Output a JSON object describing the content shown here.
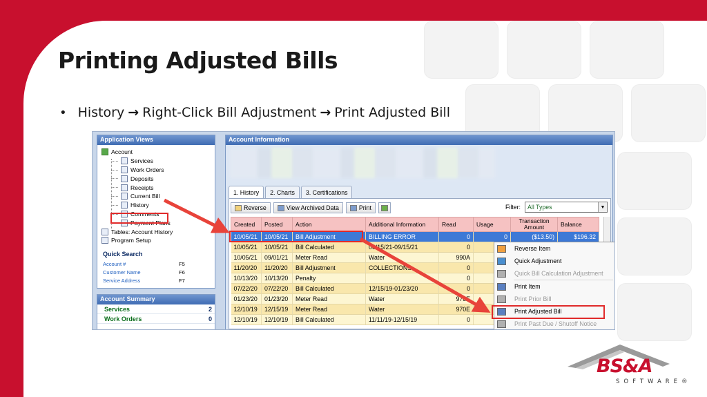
{
  "slide": {
    "title": "Printing Adjusted Bills",
    "bullet": {
      "step1": "History",
      "step2": "Right-Click Bill Adjustment",
      "step3": "Print Adjusted Bill"
    }
  },
  "app_views": {
    "header": "Application Views",
    "root": "Account",
    "items": [
      "Services",
      "Work Orders",
      "Deposits",
      "Receipts",
      "Current Bill",
      "History",
      "Comments",
      "Payment Plans"
    ],
    "tables": "Tables: Account History",
    "program_setup": "Program Setup"
  },
  "quick_search": {
    "title": "Quick Search",
    "rows": [
      {
        "label": "Account #",
        "key": "F5"
      },
      {
        "label": "Customer Name",
        "key": "F6"
      },
      {
        "label": "Service Address",
        "key": "F7"
      }
    ]
  },
  "account_summary": {
    "header": "Account Summary",
    "rows": [
      {
        "label": "Services",
        "value": "2"
      },
      {
        "label": "Work Orders",
        "value": "0"
      }
    ]
  },
  "account_info": {
    "header": "Account Information"
  },
  "tabs": [
    "1. History",
    "2. Charts",
    "3. Certifications"
  ],
  "toolbar": {
    "reverse": "Reverse",
    "view_archived": "View Archived Data",
    "print": "Print",
    "filter_label": "Filter:",
    "filter_value": "All Types"
  },
  "grid": {
    "columns": [
      "Created",
      "Posted",
      "Action",
      "Additional Information",
      "Read",
      "Usage",
      "Transaction Amount",
      "Balance"
    ],
    "rows": [
      [
        "10/05/21",
        "10/05/21",
        "Bill Adjustment",
        "BILLING ERROR",
        "0",
        "0",
        "($13.50)",
        "$196.32"
      ],
      [
        "10/05/21",
        "10/05/21",
        "Bill Calculated",
        "06/15/21-09/15/21",
        "0",
        "",
        "",
        ""
      ],
      [
        "10/05/21",
        "09/01/21",
        "Meter Read",
        "Water",
        "990A",
        "",
        "",
        ""
      ],
      [
        "11/20/20",
        "11/20/20",
        "Bill Adjustment",
        "COLLECTIONS",
        "0",
        "",
        "",
        ""
      ],
      [
        "10/13/20",
        "10/13/20",
        "Penalty",
        "",
        "0",
        "",
        "",
        ""
      ],
      [
        "07/22/20",
        "07/22/20",
        "Bill Calculated",
        "12/15/19-01/23/20",
        "0",
        "",
        "",
        ""
      ],
      [
        "01/23/20",
        "01/23/20",
        "Meter Read",
        "Water",
        "978E",
        "",
        "",
        ""
      ],
      [
        "12/10/19",
        "12/15/19",
        "Meter Read",
        "Water",
        "970E",
        "",
        "",
        ""
      ],
      [
        "12/10/19",
        "12/10/19",
        "Bill Calculated",
        "11/11/19-12/15/19",
        "0",
        "",
        "",
        ""
      ]
    ]
  },
  "context_menu": {
    "items": [
      {
        "label": "Reverse Item",
        "disabled": false
      },
      {
        "label": "Quick Adjustment",
        "disabled": false
      },
      {
        "label": "Quick Bill Calculation Adjustment",
        "disabled": true
      },
      {
        "label": "Print Item",
        "disabled": false
      },
      {
        "label": "Print Prior Bill",
        "disabled": true
      },
      {
        "label": "Print Adjusted Bill",
        "disabled": false
      },
      {
        "label": "Print Past Due / Shutoff Notice",
        "disabled": true
      }
    ]
  },
  "logo": {
    "name": "BS&A",
    "sub": "SOFTWARE®"
  },
  "colors": {
    "brand_red": "#c8102e",
    "highlight_red": "#e02a2a",
    "header_blue": "#3f6cb3",
    "row_selected": "#3d79d6"
  }
}
